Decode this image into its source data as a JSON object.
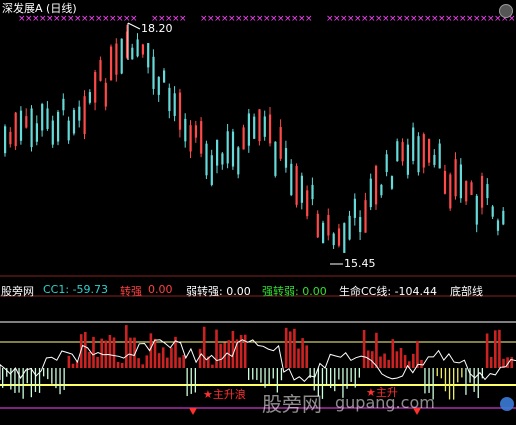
{
  "header": {
    "title": "深发展A (日线)",
    "title_color": "#ffffff"
  },
  "price_panel": {
    "high_label": "18.20",
    "low_label": "15.45",
    "up_color": "#ff4a4a",
    "down_color": "#66d9d9",
    "marker_color": "#ff44ff",
    "marker_glyph": "×"
  },
  "legend": {
    "site": "股旁网",
    "cc1_label": "CC1: -59.73",
    "turn_strong_label": "转强",
    "turn_strong_value": "0.00",
    "weak_to_strong_label": "弱转强: 0.00",
    "strong_to_weak_label": "强转弱: 0.00",
    "life_cc_label": "生命CC线: -104.44",
    "bottom_line_label": "底部线",
    "colors": {
      "site": "#ffffff",
      "cc1": "#30d0d0",
      "turn_strong": "#ff4040",
      "turn_strong_value": "#ff4040",
      "weak_to_strong": "#ffffff",
      "strong_to_weak": "#30e030",
      "life_cc": "#ffffff",
      "bottom": "#ffffff"
    }
  },
  "indicator_panel": {
    "star_label": "★主升浪",
    "star_label_2": "★主升"
  },
  "watermark": {
    "text": "股旁网",
    "text2": "gupang.com"
  },
  "chart_data": {
    "type": "candlestick",
    "high": 18.2,
    "low": 15.45,
    "indicator_type": "bar"
  }
}
